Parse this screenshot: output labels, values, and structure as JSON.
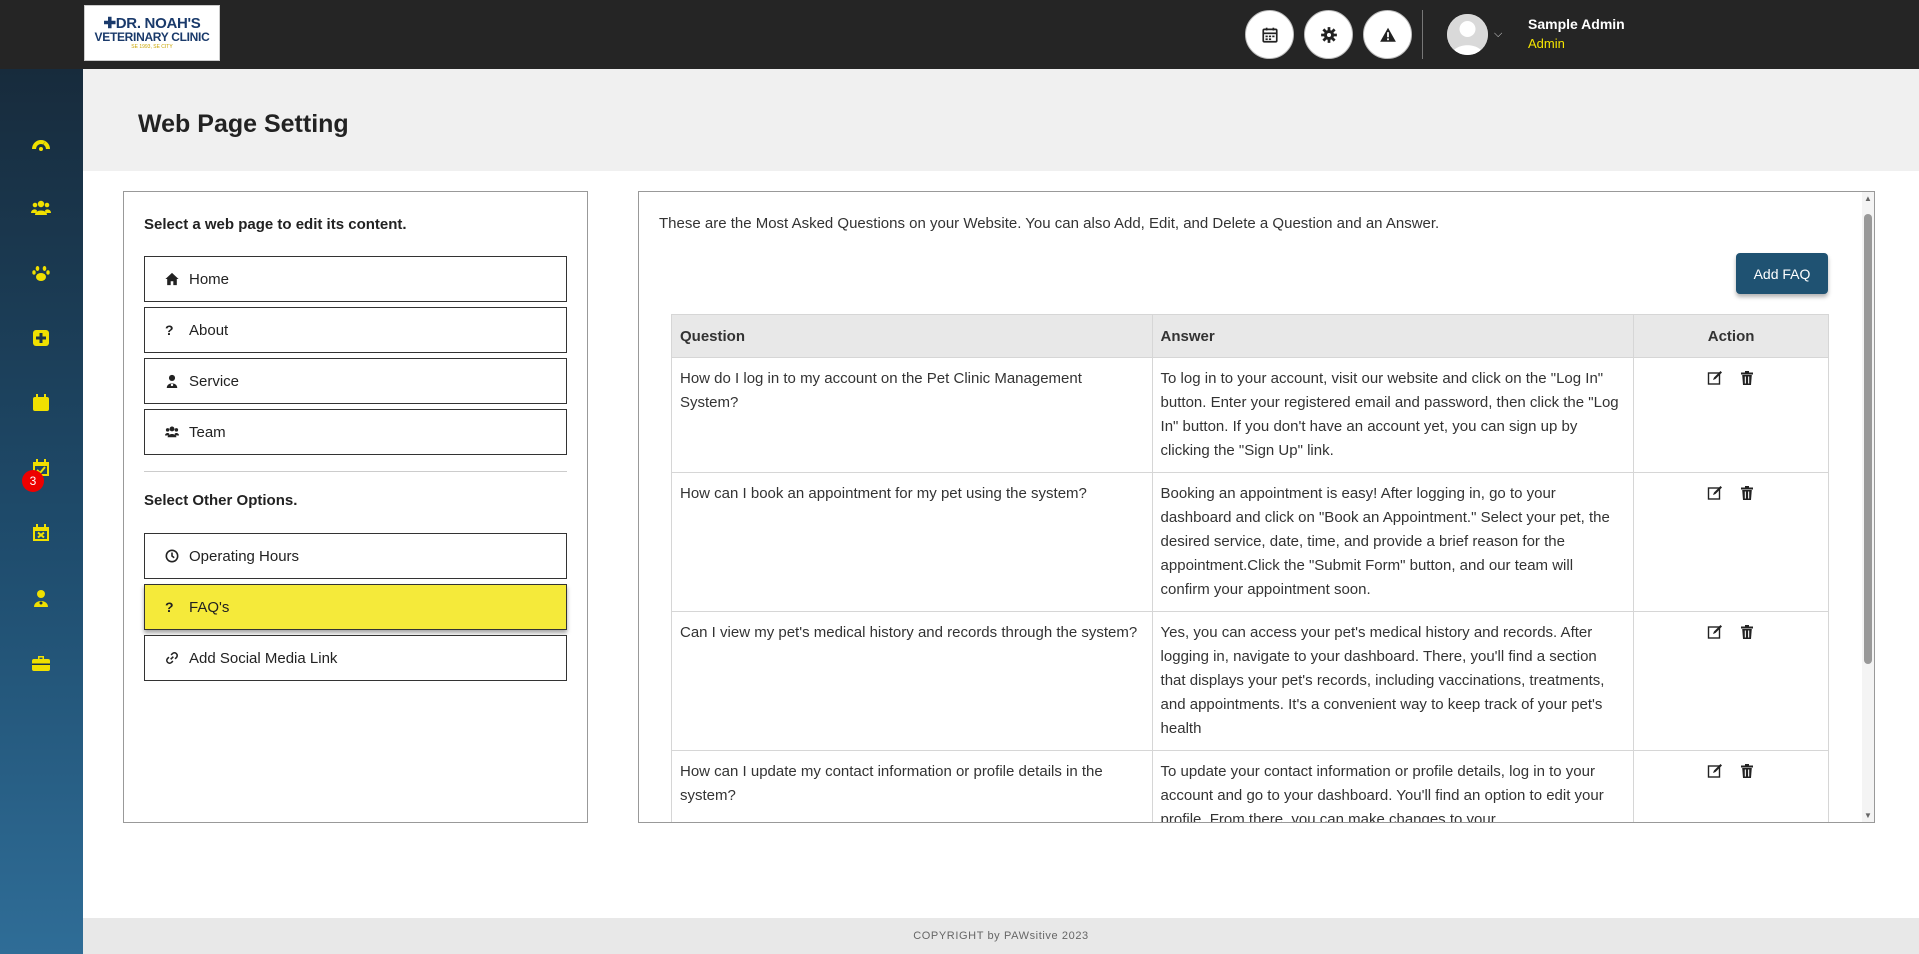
{
  "logo": {
    "line1": "✚DR. NOAH'S",
    "line2": "VETERINARY CLINIC",
    "line3": "SE 1993, SE CITY"
  },
  "user": {
    "name": "Sample Admin",
    "role": "Admin"
  },
  "sidebar": {
    "badge": "3"
  },
  "page": {
    "title": "Web Page Setting"
  },
  "left_panel": {
    "heading": "Select a web page to edit its content.",
    "pages": [
      {
        "label": "Home",
        "icon": "home-icon"
      },
      {
        "label": "About",
        "icon": "question-icon"
      },
      {
        "label": "Service",
        "icon": "user-doctor-icon"
      },
      {
        "label": "Team",
        "icon": "users-icon"
      }
    ],
    "other_heading": "Select Other Options.",
    "options": [
      {
        "label": "Operating Hours",
        "icon": "clock-icon"
      },
      {
        "label": "FAQ's",
        "icon": "question-icon",
        "active": true
      },
      {
        "label": "Add Social Media Link",
        "icon": "link-icon"
      }
    ]
  },
  "faq": {
    "intro": "These are the Most Asked Questions on your Website. You can also Add, Edit, and Delete a Question and an Answer.",
    "add_button": "Add FAQ",
    "columns": [
      "Question",
      "Answer",
      "Action"
    ],
    "rows": [
      {
        "question": "How do I log in to my account on the Pet Clinic Management System?",
        "answer": "To log in to your account, visit our website and click on the \"Log In\" button. Enter your registered email and password, then click the \"Log In\" button. If you don't have an account yet, you can sign up by clicking the \"Sign Up\" link."
      },
      {
        "question": "How can I book an appointment for my pet using the system?",
        "answer": "Booking an appointment is easy! After logging in, go to your dashboard and click on \"Book an Appointment.\" Select your pet, the desired service, date, time, and provide a brief reason for the appointment.Click the \"Submit Form\" button, and our team will confirm your appointment soon."
      },
      {
        "question": "Can I view my pet's medical history and records through the system?",
        "answer": "Yes, you can access your pet's medical history and records. After logging in, navigate to your dashboard. There, you'll find a section that displays your pet's records, including vaccinations, treatments, and appointments. It's a convenient way to keep track of your pet's health"
      },
      {
        "question": "How can I update my contact information or profile details in the system?",
        "answer": "To update your contact information or profile details, log in to your account and go to your dashboard. You'll find an option to edit your profile. From there, you can make changes to your"
      }
    ]
  },
  "footer": {
    "text": "COPYRIGHT by PAWsitive 2023"
  },
  "colors": {
    "accent_yellow": "#f5ea3a",
    "primary_button": "#1f5272",
    "topbar": "#252525",
    "badge": "#e00000"
  }
}
